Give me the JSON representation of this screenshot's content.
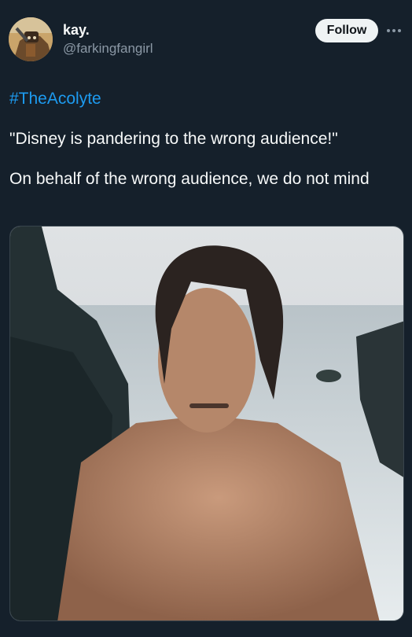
{
  "user": {
    "display_name": "kay.",
    "handle": "@farkingfangirl",
    "follow_label": "Follow",
    "more_icon": "more-icon"
  },
  "tweet": {
    "hashtag": "#TheAcolyte",
    "quote": "\"Disney is pandering to the wrong audience!\"",
    "response": "On behalf of the wrong audience, we do not mind"
  },
  "colors": {
    "background": "#15202b",
    "link": "#1d9bf0",
    "follow_bg": "#eff3f4",
    "secondary_text": "#8b98a5"
  }
}
